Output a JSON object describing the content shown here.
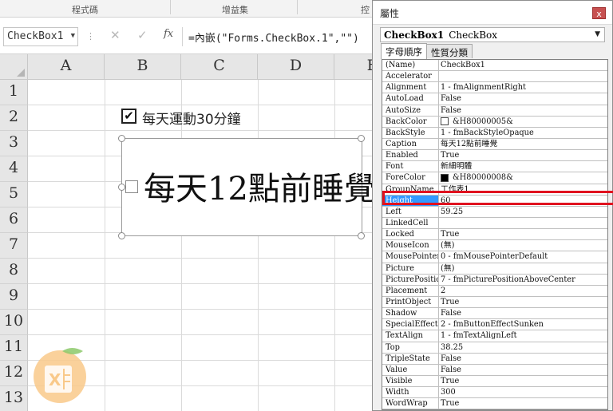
{
  "ribbon": {
    "groups": [
      "程式碼",
      "增益集",
      "控"
    ]
  },
  "formula_bar": {
    "name_box": "CheckBox1",
    "cancel": "✕",
    "enter": "✓",
    "fx": "fx",
    "formula": "=內嵌(\"Forms.CheckBox.1\",\"\")"
  },
  "sheet": {
    "columns": [
      "A",
      "B",
      "C",
      "D",
      "E"
    ],
    "rows": [
      "1",
      "2",
      "3",
      "4",
      "5",
      "6",
      "7",
      "8",
      "9",
      "10",
      "11",
      "12",
      "13"
    ]
  },
  "checkbox1": {
    "label": "每天運動30分鐘",
    "checked": true,
    "mark": "✔"
  },
  "checkbox2": {
    "label": "每天12點前睡覺",
    "checked": false
  },
  "properties": {
    "title": "屬性",
    "close": "x",
    "object_name": "CheckBox1",
    "object_type": "CheckBox",
    "tabs": [
      "字母順序",
      "性質分類"
    ],
    "active_tab": 0,
    "selected_property": "Height",
    "colors": {
      "BackColor": "#ffffff",
      "ForeColor": "#000000",
      "selection": "#3399ff",
      "highlight": "#e0121f"
    },
    "rows": [
      {
        "name": "(Name)",
        "value": "CheckBox1"
      },
      {
        "name": "Accelerator",
        "value": ""
      },
      {
        "name": "Alignment",
        "value": "1 - fmAlignmentRight"
      },
      {
        "name": "AutoLoad",
        "value": "False"
      },
      {
        "name": "AutoSize",
        "value": "False"
      },
      {
        "name": "BackColor",
        "value": "&H80000005&"
      },
      {
        "name": "BackStyle",
        "value": "1 - fmBackStyleOpaque"
      },
      {
        "name": "Caption",
        "value": "每天12點前睡覺"
      },
      {
        "name": "Enabled",
        "value": "True"
      },
      {
        "name": "Font",
        "value": "新細明體"
      },
      {
        "name": "ForeColor",
        "value": "&H80000008&"
      },
      {
        "name": "GroupName",
        "value": "工作表1"
      },
      {
        "name": "Height",
        "value": "60"
      },
      {
        "name": "Left",
        "value": "59.25"
      },
      {
        "name": "LinkedCell",
        "value": ""
      },
      {
        "name": "Locked",
        "value": "True"
      },
      {
        "name": "MouseIcon",
        "value": "(無)"
      },
      {
        "name": "MousePointer",
        "value": "0 - fmMousePointerDefault"
      },
      {
        "name": "Picture",
        "value": "(無)"
      },
      {
        "name": "PicturePosition",
        "value": "7 - fmPicturePositionAboveCenter"
      },
      {
        "name": "Placement",
        "value": "2"
      },
      {
        "name": "PrintObject",
        "value": "True"
      },
      {
        "name": "Shadow",
        "value": "False"
      },
      {
        "name": "SpecialEffect",
        "value": "2 - fmButtonEffectSunken"
      },
      {
        "name": "TextAlign",
        "value": "1 - fmTextAlignLeft"
      },
      {
        "name": "Top",
        "value": "38.25"
      },
      {
        "name": "TripleState",
        "value": "False"
      },
      {
        "name": "Value",
        "value": "False"
      },
      {
        "name": "Visible",
        "value": "True"
      },
      {
        "name": "Width",
        "value": "300"
      },
      {
        "name": "WordWrap",
        "value": "True"
      }
    ]
  }
}
